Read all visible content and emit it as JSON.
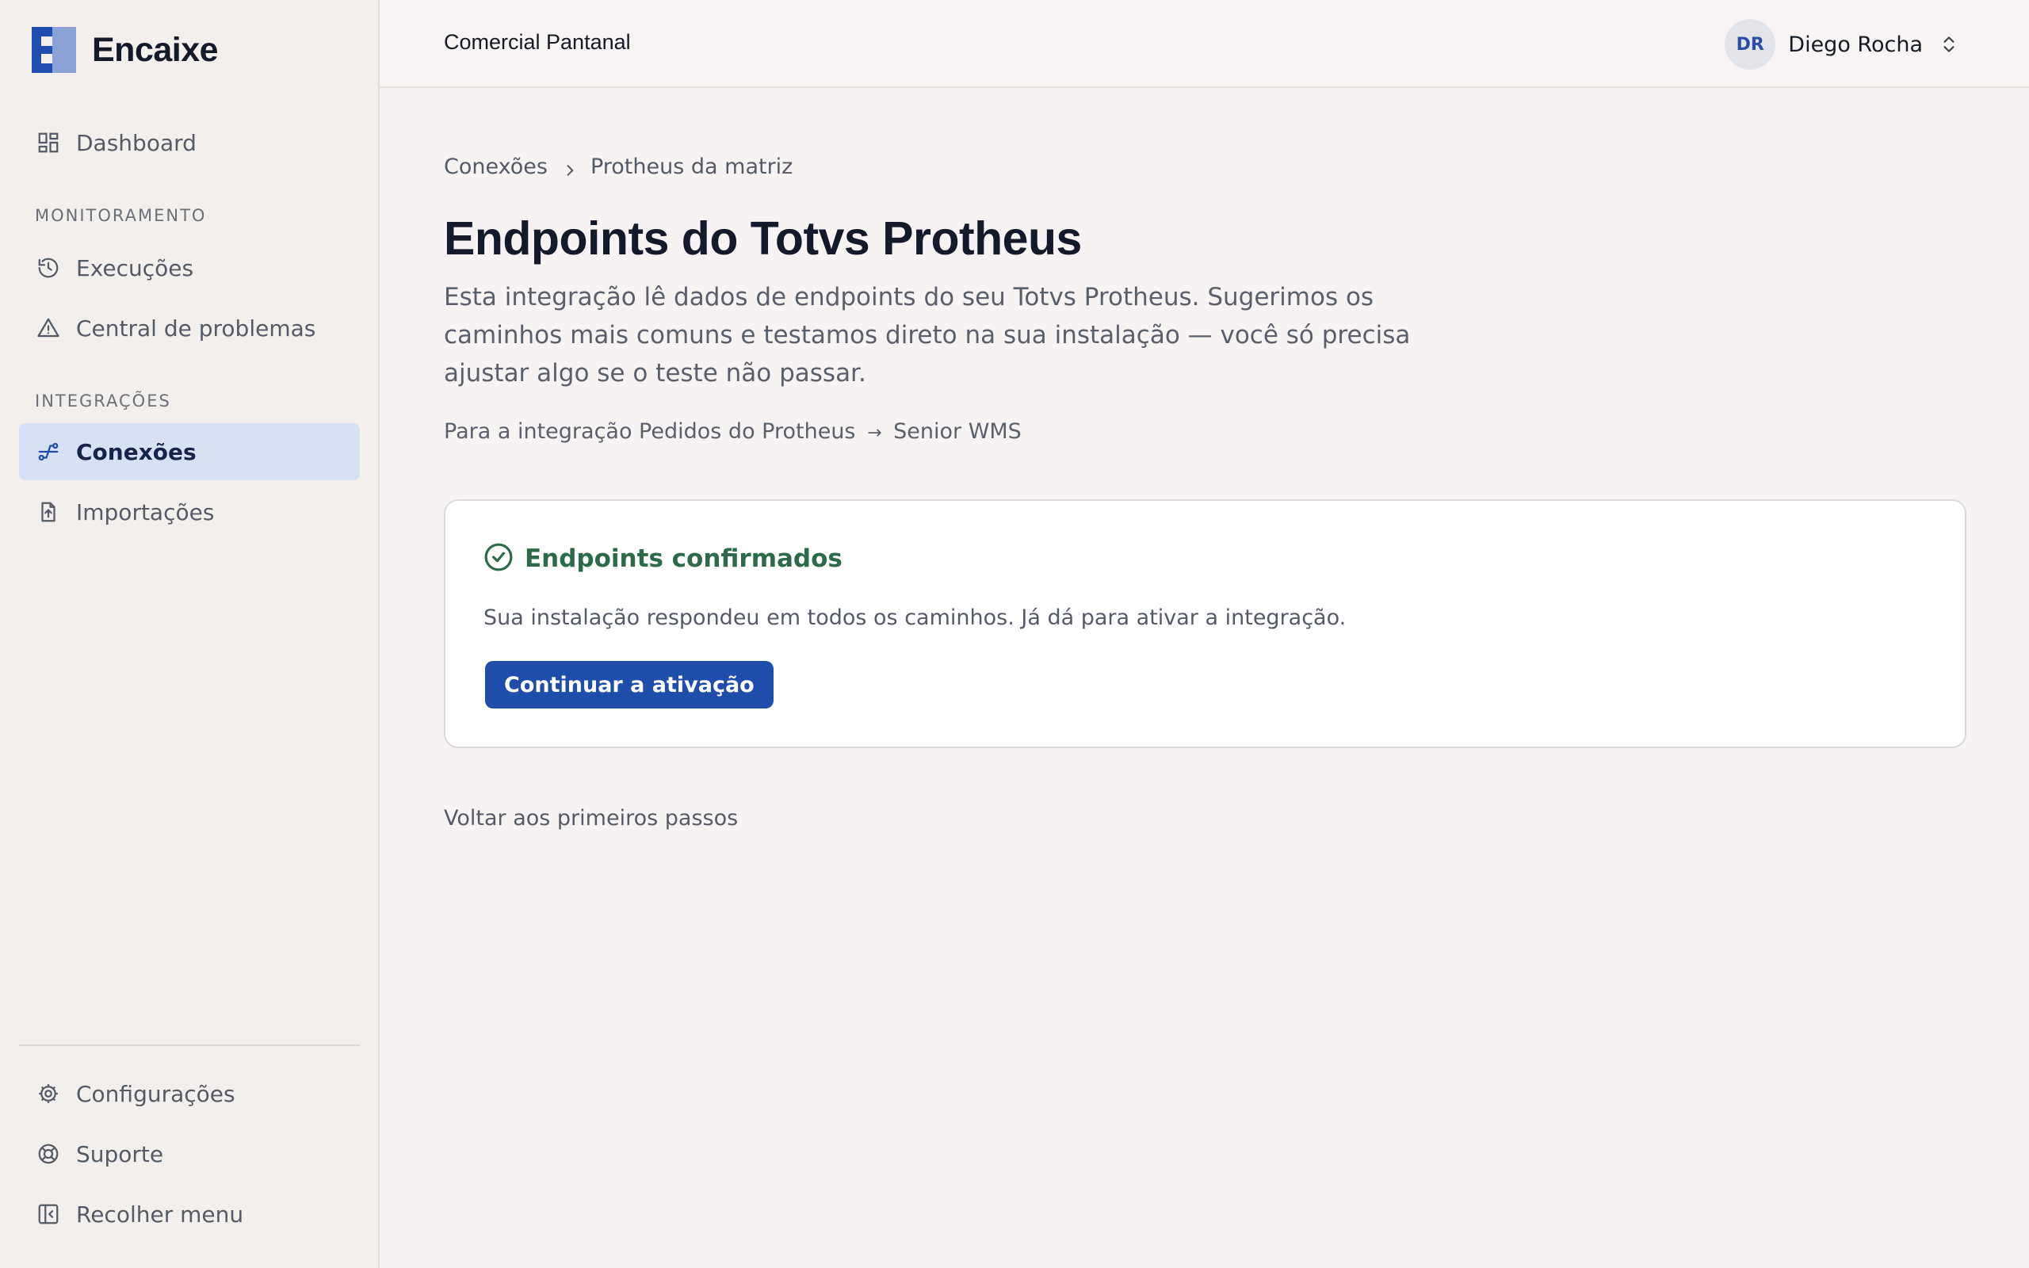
{
  "brand": {
    "name": "Encaixe"
  },
  "sidebar": {
    "dashboard": "Dashboard",
    "section_monitoring": "MONITORAMENTO",
    "executions": "Execuções",
    "problems": "Central de problemas",
    "section_integrations": "INTEGRAÇÕES",
    "connections": "Conexões",
    "imports": "Importações",
    "settings": "Configurações",
    "support": "Suporte",
    "collapse": "Recolher menu"
  },
  "topbar": {
    "org": "Comercial Pantanal",
    "user_initials": "DR",
    "user_name": "Diego Rocha"
  },
  "breadcrumb": {
    "parent": "Conexões",
    "current": "Protheus da matriz"
  },
  "page": {
    "title": "Endpoints do Totvs Protheus",
    "description": "Esta integração lê dados de endpoints do seu Totvs Protheus. Sugerimos os caminhos mais comuns e testamos direto na sua instalação — você só precisa ajustar algo se o teste não passar.",
    "integration_prefix": "Para a integração Pedidos do Protheus",
    "integration_arrow": "→",
    "integration_target": "Senior WMS"
  },
  "status_card": {
    "title": "Endpoints confirmados",
    "message": "Sua instalação respondeu em todos os caminhos. Já dá para ativar a integração.",
    "button": "Continuar a ativação",
    "color_success": "#2c6b4a"
  },
  "back_link": "Voltar aos primeiros passos",
  "colors": {
    "accent": "#1e4dab",
    "active_bg": "#d6e1f4"
  }
}
